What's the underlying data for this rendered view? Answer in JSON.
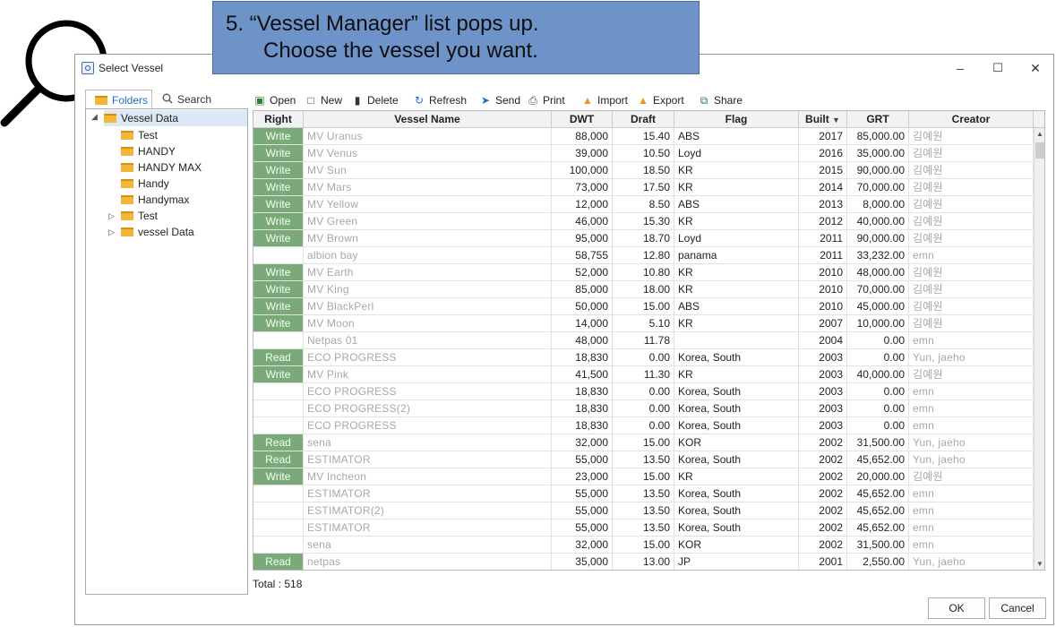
{
  "callout": {
    "line1": "5. “Vessel Manager” list pops up.",
    "line2": "Choose the vessel you want."
  },
  "window": {
    "title": "Select Vessel",
    "minimize": "–",
    "maximize": "☐",
    "close": "✕"
  },
  "left_panel": {
    "tabs": {
      "folders": "Folders",
      "search": "Search"
    },
    "tree": [
      {
        "label": "Vessel Data",
        "level": 0,
        "expanded": true
      },
      {
        "label": "Test",
        "level": 1
      },
      {
        "label": "HANDY",
        "level": 1
      },
      {
        "label": "HANDY MAX",
        "level": 1
      },
      {
        "label": "Handy",
        "level": 1
      },
      {
        "label": "Handymax",
        "level": 1
      },
      {
        "label": "Test",
        "level": 1,
        "collapsed": true
      },
      {
        "label": "vessel Data",
        "level": 1,
        "collapsed": true
      }
    ]
  },
  "toolbar": {
    "open": "Open",
    "new": "New",
    "delete": "Delete",
    "refresh": "Refresh",
    "send": "Send",
    "print": "Print",
    "import": "Import",
    "export": "Export",
    "share": "Share"
  },
  "grid": {
    "columns": [
      "Right",
      "Vessel Name",
      "DWT",
      "Draft",
      "Flag",
      "Built",
      "GRT",
      "Creator"
    ],
    "sort_indicator": "▼",
    "rows": [
      {
        "right": "Write",
        "name": "MV Uranus",
        "dwt": "88,000",
        "draft": "15.40",
        "flag": "ABS",
        "built": "2017",
        "grt": "85,000.00",
        "creator": "김예원"
      },
      {
        "right": "Write",
        "name": "MV Venus",
        "dwt": "39,000",
        "draft": "10.50",
        "flag": "Loyd",
        "built": "2016",
        "grt": "35,000.00",
        "creator": "김예원"
      },
      {
        "right": "Write",
        "name": "MV Sun",
        "dwt": "100,000",
        "draft": "18.50",
        "flag": "KR",
        "built": "2015",
        "grt": "90,000.00",
        "creator": "김예원"
      },
      {
        "right": "Write",
        "name": "MV Mars",
        "dwt": "73,000",
        "draft": "17.50",
        "flag": "KR",
        "built": "2014",
        "grt": "70,000.00",
        "creator": "김예원"
      },
      {
        "right": "Write",
        "name": "MV Yellow",
        "dwt": "12,000",
        "draft": "8.50",
        "flag": "ABS",
        "built": "2013",
        "grt": "8,000.00",
        "creator": "김예원"
      },
      {
        "right": "Write",
        "name": "MV Green",
        "dwt": "46,000",
        "draft": "15.30",
        "flag": "KR",
        "built": "2012",
        "grt": "40,000.00",
        "creator": "김예원"
      },
      {
        "right": "Write",
        "name": "MV Brown",
        "dwt": "95,000",
        "draft": "18.70",
        "flag": "Loyd",
        "built": "2011",
        "grt": "90,000.00",
        "creator": "김예원"
      },
      {
        "right": "",
        "name": "albion bay",
        "dwt": "58,755",
        "draft": "12.80",
        "flag": "panama",
        "built": "2011",
        "grt": "33,232.00",
        "creator": "emn"
      },
      {
        "right": "Write",
        "name": "MV Earth",
        "dwt": "52,000",
        "draft": "10.80",
        "flag": "KR",
        "built": "2010",
        "grt": "48,000.00",
        "creator": "김예원"
      },
      {
        "right": "Write",
        "name": "MV King",
        "dwt": "85,000",
        "draft": "18.00",
        "flag": "KR",
        "built": "2010",
        "grt": "70,000.00",
        "creator": "김예원"
      },
      {
        "right": "Write",
        "name": "MV BlackPerl",
        "dwt": "50,000",
        "draft": "15.00",
        "flag": "ABS",
        "built": "2010",
        "grt": "45,000.00",
        "creator": "김예원"
      },
      {
        "right": "Write",
        "name": "MV Moon",
        "dwt": "14,000",
        "draft": "5.10",
        "flag": "KR",
        "built": "2007",
        "grt": "10,000.00",
        "creator": "김예원"
      },
      {
        "right": "",
        "name": "Netpas 01",
        "dwt": "48,000",
        "draft": "11.78",
        "flag": "",
        "built": "2004",
        "grt": "0.00",
        "creator": "emn"
      },
      {
        "right": "Read",
        "name": "ECO PROGRESS",
        "dwt": "18,830",
        "draft": "0.00",
        "flag": "Korea, South",
        "built": "2003",
        "grt": "0.00",
        "creator": "Yun, jaeho"
      },
      {
        "right": "Write",
        "name": "MV Pink",
        "dwt": "41,500",
        "draft": "11.30",
        "flag": "KR",
        "built": "2003",
        "grt": "40,000.00",
        "creator": "김예원"
      },
      {
        "right": "",
        "name": "ECO PROGRESS",
        "dwt": "18,830",
        "draft": "0.00",
        "flag": "Korea, South",
        "built": "2003",
        "grt": "0.00",
        "creator": "emn"
      },
      {
        "right": "",
        "name": "ECO PROGRESS(2)",
        "dwt": "18,830",
        "draft": "0.00",
        "flag": "Korea, South",
        "built": "2003",
        "grt": "0.00",
        "creator": "emn"
      },
      {
        "right": "",
        "name": "ECO PROGRESS",
        "dwt": "18,830",
        "draft": "0.00",
        "flag": "Korea, South",
        "built": "2003",
        "grt": "0.00",
        "creator": "emn"
      },
      {
        "right": "Read",
        "name": "sena",
        "dwt": "32,000",
        "draft": "15.00",
        "flag": "KOR",
        "built": "2002",
        "grt": "31,500.00",
        "creator": "Yun, jaeho"
      },
      {
        "right": "Read",
        "name": "ESTIMATOR",
        "dwt": "55,000",
        "draft": "13.50",
        "flag": "Korea, South",
        "built": "2002",
        "grt": "45,652.00",
        "creator": "Yun, jaeho"
      },
      {
        "right": "Write",
        "name": "MV Incheon",
        "dwt": "23,000",
        "draft": "15.00",
        "flag": "KR",
        "built": "2002",
        "grt": "20,000.00",
        "creator": "김예원"
      },
      {
        "right": "",
        "name": "ESTIMATOR",
        "dwt": "55,000",
        "draft": "13.50",
        "flag": "Korea, South",
        "built": "2002",
        "grt": "45,652.00",
        "creator": "emn"
      },
      {
        "right": "",
        "name": "ESTIMATOR(2)",
        "dwt": "55,000",
        "draft": "13.50",
        "flag": "Korea, South",
        "built": "2002",
        "grt": "45,652.00",
        "creator": "emn"
      },
      {
        "right": "",
        "name": "ESTIMATOR",
        "dwt": "55,000",
        "draft": "13.50",
        "flag": "Korea, South",
        "built": "2002",
        "grt": "45,652.00",
        "creator": "emn"
      },
      {
        "right": "",
        "name": "sena",
        "dwt": "32,000",
        "draft": "15.00",
        "flag": "KOR",
        "built": "2002",
        "grt": "31,500.00",
        "creator": "emn"
      },
      {
        "right": "Read",
        "name": "netpas",
        "dwt": "35,000",
        "draft": "13.00",
        "flag": "JP",
        "built": "2001",
        "grt": "2,550.00",
        "creator": "Yun, jaeho"
      }
    ]
  },
  "footer": {
    "total": "Total : 518",
    "ok": "OK",
    "cancel": "Cancel"
  },
  "colors": {
    "callout_bg": "#6d93c9",
    "right_cell_bg": "#7aaa7a",
    "tab_active": "#1e6fc8",
    "folder": "#f2b63a"
  },
  "icons": {
    "magnifier": "magnifier-icon",
    "folder": "folder-icon",
    "search": "search-icon"
  }
}
